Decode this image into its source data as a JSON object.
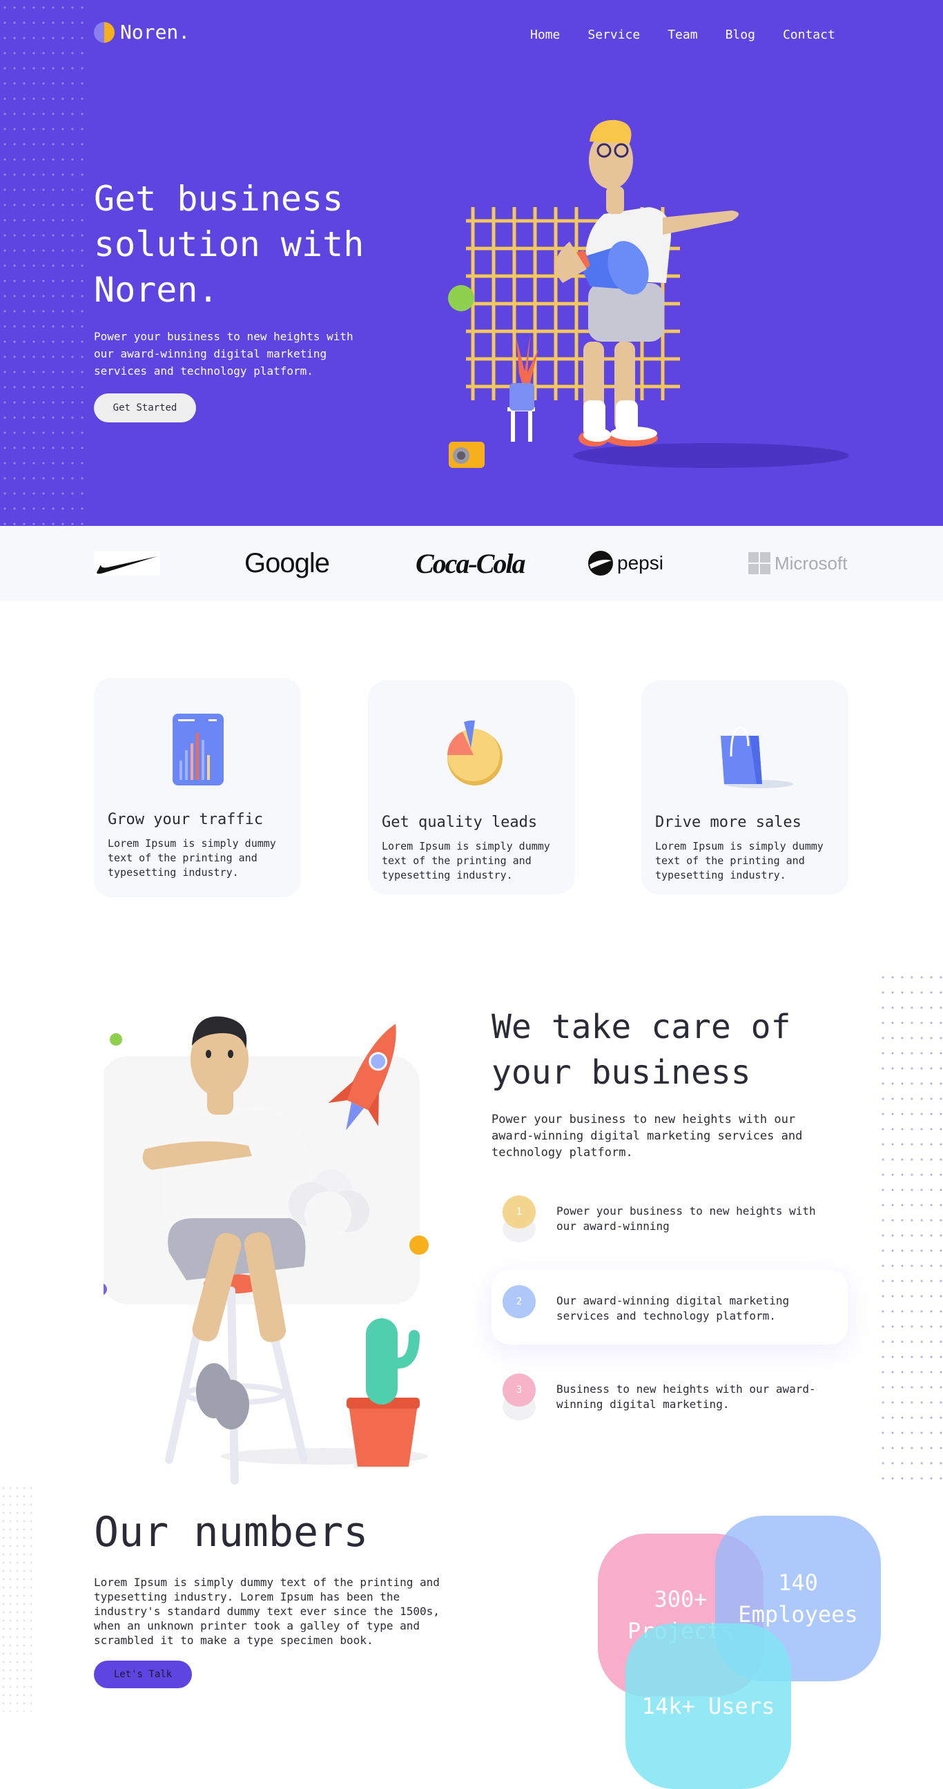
{
  "brand": {
    "name": "Noren."
  },
  "nav": {
    "items": [
      "Home",
      "Service",
      "Team",
      "Blog",
      "Contact"
    ]
  },
  "hero": {
    "title": "Get business solution with Noren.",
    "text": "Power your business to new heights with our award-winning digital marketing services and technology platform.",
    "cta": "Get Started"
  },
  "brands": {
    "google": "Google",
    "cocacola": "Coca-Cola",
    "pepsi": "pepsi",
    "microsoft": "Microsoft"
  },
  "features": [
    {
      "title": "Grow your traffic",
      "text": "Lorem Ipsum is simply dummy text of the printing and typesetting industry.",
      "icon": "bar-chart-icon"
    },
    {
      "title": "Get quality leads",
      "text": "Lorem Ipsum is simply dummy text of the printing and typesetting industry.",
      "icon": "pie-chart-icon"
    },
    {
      "title": "Drive more sales",
      "text": "Lorem Ipsum is simply dummy text of the printing and typesetting industry.",
      "icon": "shopping-bag-icon"
    }
  ],
  "care": {
    "title": "We take care of your business",
    "text": "Power your business to new heights with our award-winning digital marketing services and technology platform.",
    "steps": [
      {
        "number": "1",
        "text": "Power your business to new heights with our award-winning",
        "color": "#f3d58f"
      },
      {
        "number": "2",
        "text": "Our award-winning digital marketing services and technology platform.",
        "color": "#aec8f8"
      },
      {
        "number": "3",
        "text": "Business to new heights with our award-winning digital marketing.",
        "color": "#f7b3c7"
      }
    ]
  },
  "numbers": {
    "title": "Our numbers",
    "text": "Lorem Ipsum is simply dummy text of the printing and typesetting industry. Lorem Ipsum has been the industry's standard dummy text ever since the 1500s, when an unknown printer took a galley of type and scrambled it to make a type specimen book.",
    "cta": "Let's Talk",
    "stats": {
      "projects_value": "300+",
      "projects_label": "Projects",
      "employees_value": "140",
      "employees_label": "Employees",
      "users": "14k+ Users"
    }
  },
  "colors": {
    "primary": "#5e45e1",
    "accent_yellow": "#f7b01b",
    "light_bg": "#f6f8fb"
  }
}
